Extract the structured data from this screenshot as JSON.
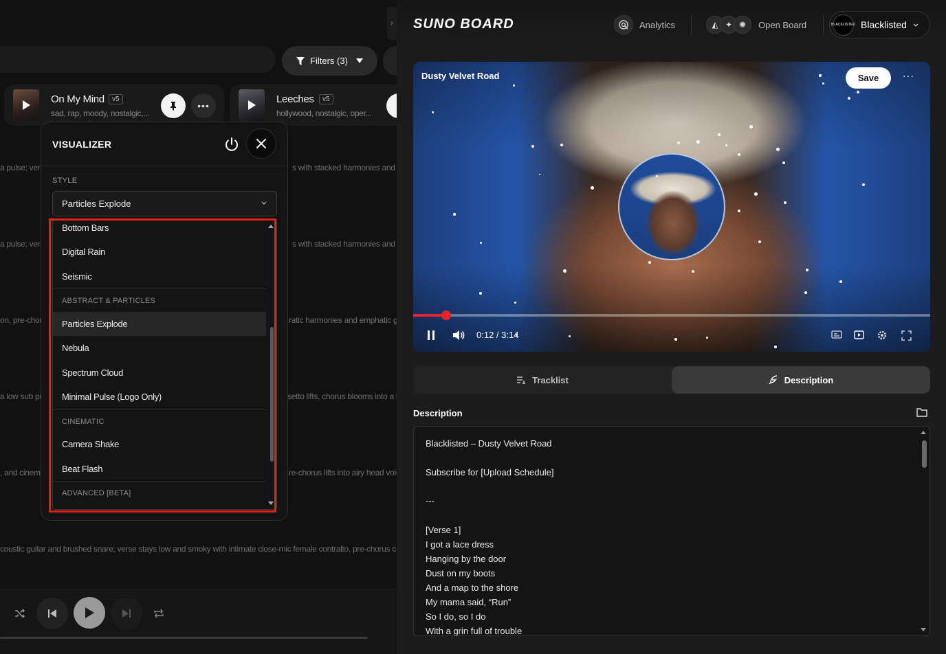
{
  "left": {
    "filters_label": "Filters (3)",
    "cards": [
      {
        "title": "On My Mind",
        "version": "v5",
        "tags": "sad, rap, moody, nostalgic,..."
      },
      {
        "title": "Leeches",
        "version": "v5",
        "tags": "hollywood, nostalgic, oper..."
      }
    ],
    "bg_lines": [
      {
        "left_text": "a pulse; vers",
        "right_text": "s with stacked harmonies and a"
      },
      {
        "left_text": "a pulse; vers",
        "right_text": "s with stacked harmonies and a"
      },
      {
        "left_text": "on, pre-chor",
        "right_text": "ratic harmonies and emphatic g"
      },
      {
        "left_text": "a low sub pul",
        "right_text": "setto lifts, chorus blooms into a l"
      },
      {
        "left_text": ", and cinem",
        "right_text": "re-chorus lifts into airy head voic"
      },
      {
        "full_text": "coustic guitar and brushed snare; verse stays low and smoky with intimate close-mic female contralto, pre-chorus c"
      }
    ]
  },
  "visualizer": {
    "title": "VISUALIZER",
    "style_label": "STYLE",
    "selected_style": "Particles Explode",
    "options": [
      {
        "kind": "item",
        "label": "Bottom Bars"
      },
      {
        "kind": "item",
        "label": "Digital Rain"
      },
      {
        "kind": "item",
        "label": "Seismic"
      },
      {
        "kind": "group",
        "label": "ABSTRACT & PARTICLES"
      },
      {
        "kind": "item",
        "label": "Particles Explode",
        "selected": true
      },
      {
        "kind": "item",
        "label": "Nebula"
      },
      {
        "kind": "item",
        "label": "Spectrum Cloud"
      },
      {
        "kind": "item",
        "label": "Minimal Pulse (Logo Only)"
      },
      {
        "kind": "group",
        "label": "CINEMATIC"
      },
      {
        "kind": "item",
        "label": "Camera Shake"
      },
      {
        "kind": "item",
        "label": "Beat Flash"
      },
      {
        "kind": "group",
        "label": "ADVANCED [BETA]"
      }
    ]
  },
  "header": {
    "logo": "SUNO BOARD",
    "analytics_label": "Analytics",
    "open_board_label": "Open Board",
    "account_name": "Blacklisted",
    "avatar_text": "BLACKLISTED"
  },
  "video": {
    "title": "Dusty Velvet Road",
    "save_label": "Save",
    "more_label": "···",
    "time": "0:12 / 3:14",
    "progress_fraction": 0.064
  },
  "tabs": [
    {
      "label": "Tracklist",
      "active": false
    },
    {
      "label": "Description",
      "active": true
    }
  ],
  "description": {
    "heading": "Description",
    "lines": [
      "Blacklisted – Dusty Velvet Road",
      "",
      "Subscribe for [Upload Schedule]",
      "",
      "---",
      "",
      "[Verse 1]",
      "I got a lace dress",
      "Hanging by the door",
      "Dust on my boots",
      "And a map to the shore",
      "My mama said, “Run”",
      "So I do, so I do",
      "With a grin full of trouble"
    ]
  },
  "colors": {
    "accent_red": "#e4232b",
    "highlight_red": "#e0211d",
    "panel_bg": "#141414"
  }
}
